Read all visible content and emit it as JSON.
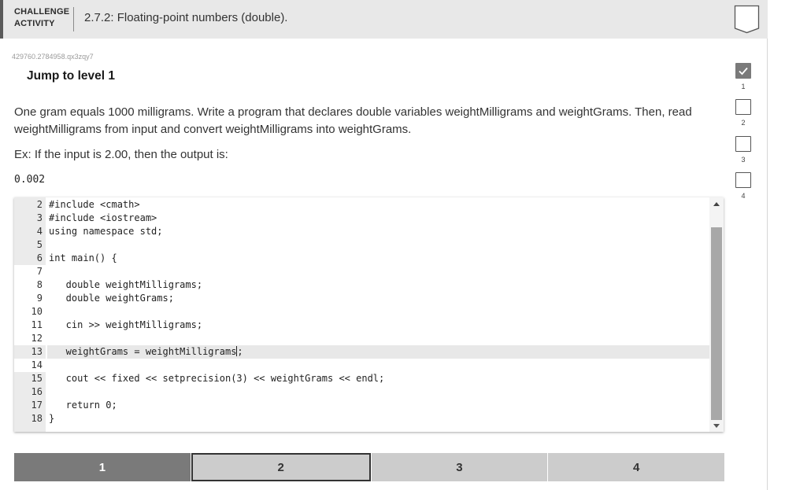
{
  "header": {
    "label_line1": "CHALLENGE",
    "label_line2": "ACTIVITY",
    "title": "2.7.2: Floating-point numbers (double)."
  },
  "activity_id": "429760.2784958.qx3zqy7",
  "jump_level": "Jump to level 1",
  "instructions": "One gram equals 1000 milligrams. Write a program that declares double variables weightMilligrams and weightGrams. Then, read weightMilligrams from input and convert weightMilligrams into weightGrams.",
  "example_text": "Ex: If the input is 2.00, then the output is:",
  "example_output": "0.002",
  "editor": {
    "lines": [
      {
        "num": "2",
        "text": "#include <cmath>"
      },
      {
        "num": "3",
        "text": "#include <iostream>"
      },
      {
        "num": "4",
        "text": "using namespace std;"
      },
      {
        "num": "5",
        "text": ""
      },
      {
        "num": "6",
        "text": "int main() {"
      },
      {
        "num": "7",
        "text": ""
      },
      {
        "num": "8",
        "text": "   double weightMilligrams;"
      },
      {
        "num": "9",
        "text": "   double weightGrams;"
      },
      {
        "num": "10",
        "text": ""
      },
      {
        "num": "11",
        "text": "   cin >> weightMilligrams;"
      },
      {
        "num": "12",
        "text": ""
      },
      {
        "num": "13",
        "text": "   weightGrams = weightMilligrams;"
      },
      {
        "num": "14",
        "text": ""
      },
      {
        "num": "15",
        "text": "   cout << fixed << setprecision(3) << weightGrams << endl;"
      },
      {
        "num": "16",
        "text": ""
      },
      {
        "num": "17",
        "text": "   return 0;"
      },
      {
        "num": "18",
        "text": "}"
      }
    ]
  },
  "levels": [
    "1",
    "2",
    "3",
    "4"
  ],
  "side_progress": [
    "1",
    "2",
    "3",
    "4"
  ],
  "colors": {
    "done": "#7a7a7a",
    "pending": "#cccccc",
    "header_bg": "#e8e8e8"
  },
  "icons": {
    "header_badge": "bookmark-badge-icon",
    "side_done": "check-icon",
    "side_pending": "empty-square-icon"
  }
}
